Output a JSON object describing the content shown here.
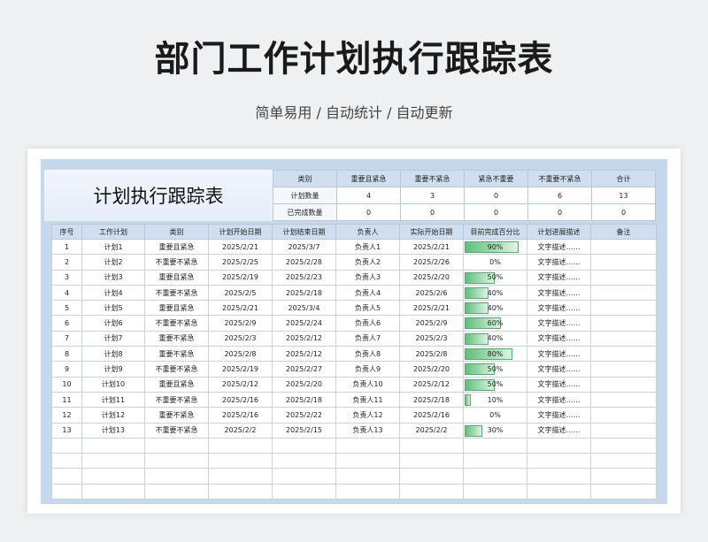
{
  "title": "部门工作计划执行跟踪表",
  "subtitle": "简单易用 / 自动统计 / 自动更新",
  "sheet_title": "计划执行跟踪表",
  "summary": {
    "head": [
      "类别",
      "重要且紧急",
      "重要不紧急",
      "紧急不重要",
      "不重要不紧急",
      "合计"
    ],
    "rows": [
      {
        "label": "计划数量",
        "values": [
          "4",
          "3",
          "0",
          "6",
          "13"
        ]
      },
      {
        "label": "已完成数量",
        "values": [
          "0",
          "0",
          "0",
          "0",
          "0"
        ]
      }
    ]
  },
  "columns": [
    "序号",
    "工作计划",
    "类别",
    "计划开始日期",
    "计划结束日期",
    "负责人",
    "实际开始日期",
    "目前完成百分比",
    "计划进展描述",
    "备注"
  ],
  "rows": [
    {
      "no": "1",
      "plan": "计划1",
      "category": "重要且紧急",
      "plan_start": "2025/2/21",
      "plan_end": "2025/3/7",
      "owner": "负责人1",
      "actual_start": "2025/2/21",
      "percent_label": "90%",
      "progress": 0.9,
      "desc": "文字描述……",
      "note": ""
    },
    {
      "no": "2",
      "plan": "计划2",
      "category": "不重要不紧急",
      "plan_start": "2025/2/25",
      "plan_end": "2025/2/28",
      "owner": "负责人2",
      "actual_start": "2025/2/26",
      "percent_label": "0%",
      "progress": 0,
      "desc": "文字描述……",
      "note": ""
    },
    {
      "no": "3",
      "plan": "计划3",
      "category": "重要且紧急",
      "plan_start": "2025/2/19",
      "plan_end": "2025/2/23",
      "owner": "负责人3",
      "actual_start": "2025/2/20",
      "percent_label": "50%",
      "progress": 0.5,
      "desc": "文字描述……",
      "note": ""
    },
    {
      "no": "4",
      "plan": "计划4",
      "category": "不重要不紧急",
      "plan_start": "2025/2/5",
      "plan_end": "2025/2/18",
      "owner": "负责人4",
      "actual_start": "2025/2/6",
      "percent_label": "40%",
      "progress": 0.4,
      "desc": "文字描述……",
      "note": ""
    },
    {
      "no": "5",
      "plan": "计划5",
      "category": "重要且紧急",
      "plan_start": "2025/2/21",
      "plan_end": "2025/3/4",
      "owner": "负责人5",
      "actual_start": "2025/2/21",
      "percent_label": "40%",
      "progress": 0.4,
      "desc": "文字描述……",
      "note": ""
    },
    {
      "no": "6",
      "plan": "计划6",
      "category": "不重要不紧急",
      "plan_start": "2025/2/9",
      "plan_end": "2025/2/24",
      "owner": "负责人6",
      "actual_start": "2025/2/9",
      "percent_label": "60%",
      "progress": 0.6,
      "desc": "文字描述……",
      "note": ""
    },
    {
      "no": "7",
      "plan": "计划7",
      "category": "重要不紧急",
      "plan_start": "2025/2/3",
      "plan_end": "2025/2/12",
      "owner": "负责人7",
      "actual_start": "2025/2/3",
      "percent_label": "40%",
      "progress": 0.4,
      "desc": "文字描述……",
      "note": ""
    },
    {
      "no": "8",
      "plan": "计划8",
      "category": "重要不紧急",
      "plan_start": "2025/2/8",
      "plan_end": "2025/2/12",
      "owner": "负责人8",
      "actual_start": "2025/2/8",
      "percent_label": "80%",
      "progress": 0.8,
      "desc": "文字描述……",
      "note": ""
    },
    {
      "no": "9",
      "plan": "计划9",
      "category": "不重要不紧急",
      "plan_start": "2025/2/19",
      "plan_end": "2025/2/27",
      "owner": "负责人9",
      "actual_start": "2025/2/20",
      "percent_label": "50%",
      "progress": 0.5,
      "desc": "文字描述……",
      "note": ""
    },
    {
      "no": "10",
      "plan": "计划10",
      "category": "重要且紧急",
      "plan_start": "2025/2/12",
      "plan_end": "2025/2/20",
      "owner": "负责人10",
      "actual_start": "2025/2/12",
      "percent_label": "50%",
      "progress": 0.5,
      "desc": "文字描述……",
      "note": ""
    },
    {
      "no": "11",
      "plan": "计划11",
      "category": "不重要不紧急",
      "plan_start": "2025/2/16",
      "plan_end": "2025/2/18",
      "owner": "负责人11",
      "actual_start": "2025/2/18",
      "percent_label": "10%",
      "progress": 0.1,
      "desc": "文字描述……",
      "note": ""
    },
    {
      "no": "12",
      "plan": "计划12",
      "category": "重要不紧急",
      "plan_start": "2025/2/16",
      "plan_end": "2025/2/22",
      "owner": "负责人12",
      "actual_start": "2025/2/16",
      "percent_label": "0%",
      "progress": 0,
      "desc": "文字描述……",
      "note": ""
    },
    {
      "no": "13",
      "plan": "计划13",
      "category": "不重要不紧急",
      "plan_start": "2025/2/2",
      "plan_end": "2025/2/15",
      "owner": "负责人13",
      "actual_start": "2025/2/2",
      "percent_label": "30%",
      "progress": 0.3,
      "desc": "文字描述……",
      "note": ""
    }
  ],
  "empty_rows": 4,
  "colors": {
    "header_bg": "#cfdfef",
    "frame": "#c6d9ec",
    "bar": "#5fc07a"
  }
}
